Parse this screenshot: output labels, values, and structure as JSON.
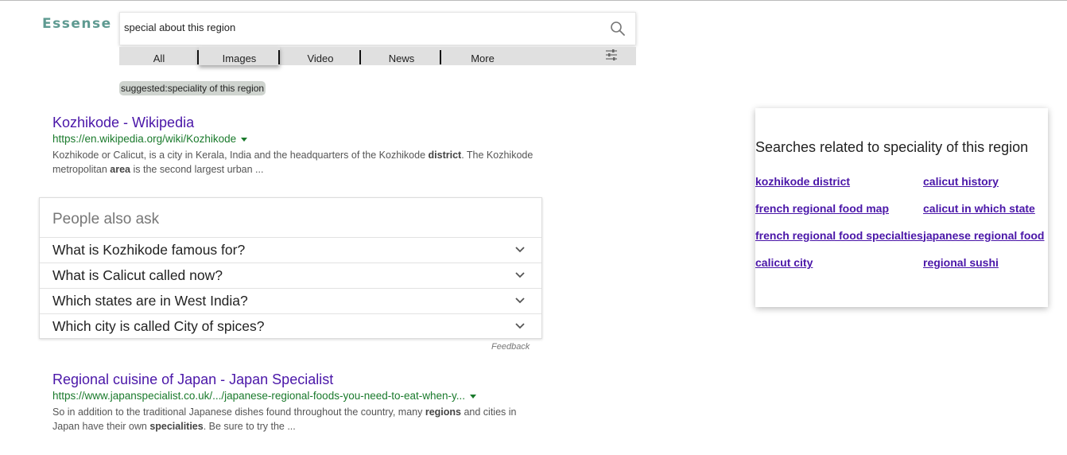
{
  "logo": "Essense",
  "search": {
    "value": "special about this region"
  },
  "tabs": [
    "All",
    "Images",
    "Video",
    "News",
    "More"
  ],
  "suggested": "suggested:speciality of this region",
  "results": [
    {
      "title": "Kozhikode - Wikipedia",
      "url": "https://en.wikipedia.org/wiki/Kozhikode",
      "snippet": [
        {
          "t": "Kozhikode or Calicut, is a city in Kerala, India and the headquarters of the Kozhikode "
        },
        {
          "t": "district",
          "b": true
        },
        {
          "t": ". The Kozhikode metropolitan "
        },
        {
          "t": "area",
          "b": true
        },
        {
          "t": " is the second largest urban ..."
        }
      ]
    },
    {
      "title": "Regional cuisine of Japan - Japan Specialist",
      "url": "https://www.japanspecialist.co.uk/.../japanese-regional-foods-you-need-to-eat-when-y...",
      "snippet": [
        {
          "t": "So in addition to the traditional Japanese dishes found throughout the country, many "
        },
        {
          "t": "regions",
          "b": true
        },
        {
          "t": " and cities in Japan have their own "
        },
        {
          "t": "specialities",
          "b": true
        },
        {
          "t": ". Be sure to try the ..."
        }
      ]
    }
  ],
  "people_also_ask": {
    "title": "People also ask",
    "questions": [
      "What is Kozhikode famous for?",
      "What is Calicut called now?",
      "Which states are in West India?",
      "Which city is called City of spices?"
    ],
    "feedback": "Feedback"
  },
  "related": {
    "title": "Searches related to speciality of this region",
    "links": [
      "kozhikode district",
      "calicut history",
      "french regional food map",
      "calicut in which state",
      "french regional food specialties",
      "japanese regional food",
      "calicut city",
      "regional sushi"
    ]
  },
  "colors": {
    "link": "#4a16a8",
    "url": "#1a7a2c",
    "logo": "#5e9a91"
  },
  "icons": [
    "search-icon",
    "settings-sliders-icon",
    "caret-down-icon",
    "chevron-down-icon"
  ]
}
